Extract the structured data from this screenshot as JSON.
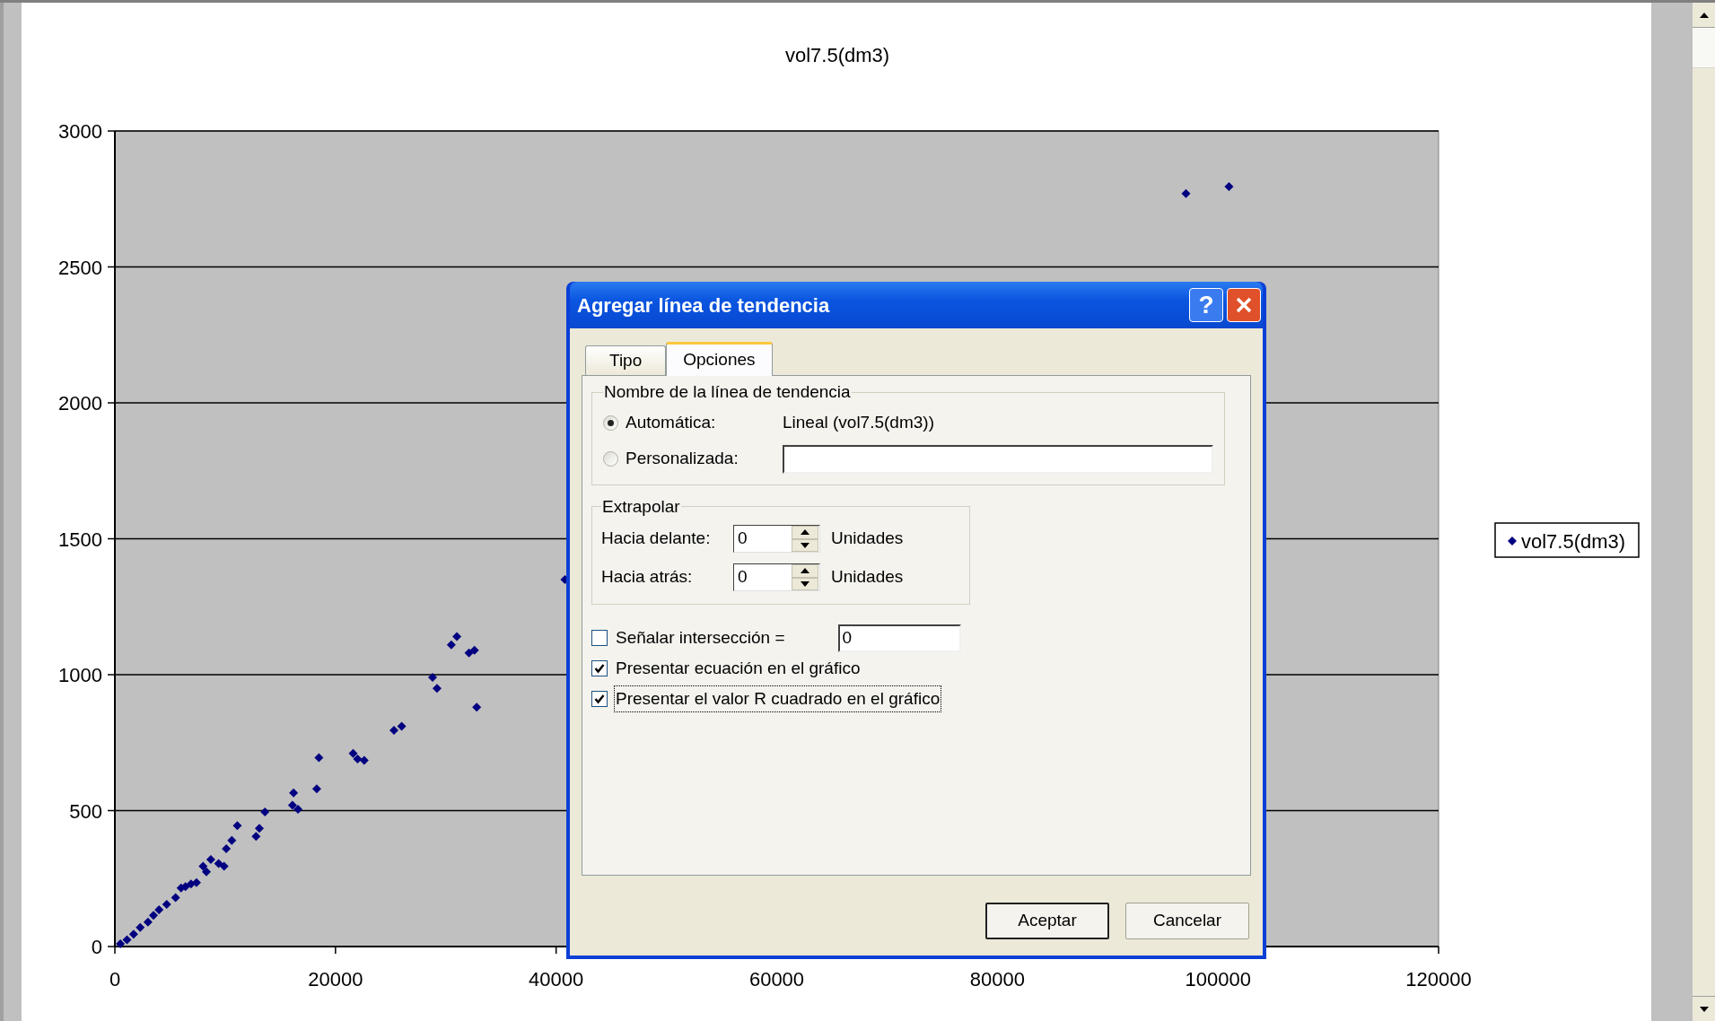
{
  "chart": {
    "chart_data": {
      "type": "scatter",
      "grid": true,
      "title": "vol7.5(dm3)",
      "x": [
        97100,
        101000,
        40800,
        28800,
        29200,
        31000,
        30500,
        32100,
        32600,
        32800,
        25300,
        26000,
        21600,
        22000,
        22600,
        18500,
        18300,
        16200,
        16100,
        16600,
        13600,
        13100,
        12800,
        11100,
        10600,
        10100,
        9900,
        9400,
        8700,
        8000,
        8300,
        7400,
        6900,
        6400,
        6000,
        5500,
        4700,
        4000,
        3500,
        3000,
        2300,
        1700,
        1100,
        500
      ],
      "series": [
        {
          "name": "vol7.5(dm3)",
          "color": "#000080",
          "values": [
            2770,
            2795,
            1350,
            990,
            950,
            1140,
            1110,
            1080,
            1090,
            880,
            795,
            810,
            710,
            690,
            685,
            695,
            580,
            565,
            520,
            505,
            495,
            435,
            405,
            445,
            390,
            360,
            295,
            305,
            320,
            295,
            275,
            235,
            230,
            220,
            215,
            180,
            155,
            135,
            115,
            90,
            70,
            45,
            25,
            10
          ]
        }
      ],
      "xlim": [
        0,
        120000
      ],
      "ylim": [
        0,
        3000
      ],
      "xticks": [
        0,
        20000,
        40000,
        60000,
        80000,
        100000,
        120000
      ],
      "yticks": [
        0,
        500,
        1000,
        1500,
        2000,
        2500,
        3000
      ]
    }
  },
  "dialog": {
    "title": "Agregar línea de tendencia",
    "help_label": "?",
    "tabs": [
      {
        "label": "Tipo",
        "selected": false
      },
      {
        "label": "Opciones",
        "selected": true
      }
    ],
    "name_group": {
      "title": "Nombre de la línea de tendencia",
      "options": [
        {
          "kind": "text",
          "label": "Automática:",
          "selected": true,
          "value": "Lineal (vol7.5(dm3))"
        },
        {
          "kind": "field",
          "label": "Personalizada:",
          "selected": false
        }
      ]
    },
    "extrapolate": {
      "title": "Extrapolar",
      "rows": [
        {
          "label": "Hacia delante:",
          "value": "0",
          "unit": "Unidades"
        },
        {
          "label": "Hacia atrás:",
          "value": "0",
          "unit": "Unidades"
        }
      ]
    },
    "checkboxes": [
      {
        "label": "Señalar intersección =",
        "checked": false,
        "focused": false,
        "field_value": "0"
      },
      {
        "label": "Presentar ecuación en el gráfico",
        "checked": true,
        "focused": false
      },
      {
        "label": "Presentar el valor R cuadrado en el gráfico",
        "checked": true,
        "focused": true
      }
    ],
    "buttons": [
      {
        "label": "Aceptar",
        "default": true
      },
      {
        "label": "Cancelar",
        "default": false
      }
    ]
  }
}
